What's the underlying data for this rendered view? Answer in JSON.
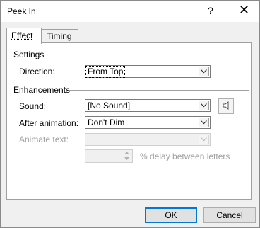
{
  "title_bar": {
    "title": "Peek In",
    "help_label": "?",
    "close_label": "✕"
  },
  "tabs": [
    {
      "label": "Effect",
      "active": true
    },
    {
      "label": "Timing",
      "active": false
    }
  ],
  "settings": {
    "group_label": "Settings",
    "direction": {
      "label": "Direction:",
      "value": "From Top"
    }
  },
  "enhancements": {
    "group_label": "Enhancements",
    "sound": {
      "label": "Sound:",
      "value": "[No Sound]",
      "speaker_icon": "speaker-icon"
    },
    "after_animation": {
      "label": "After animation:",
      "value": "Don't Dim"
    },
    "animate_text": {
      "label": "Animate text:",
      "value": "",
      "enabled": false
    },
    "delay": {
      "value": "",
      "suffix": "% delay between letters",
      "enabled": false
    }
  },
  "buttons": {
    "ok": "OK",
    "cancel": "Cancel"
  },
  "colors": {
    "accent": "#0078d7",
    "disabled_text": "#a0a0a0",
    "panel_bg": "#ffffff",
    "dialog_bg": "#f0f0f0"
  }
}
